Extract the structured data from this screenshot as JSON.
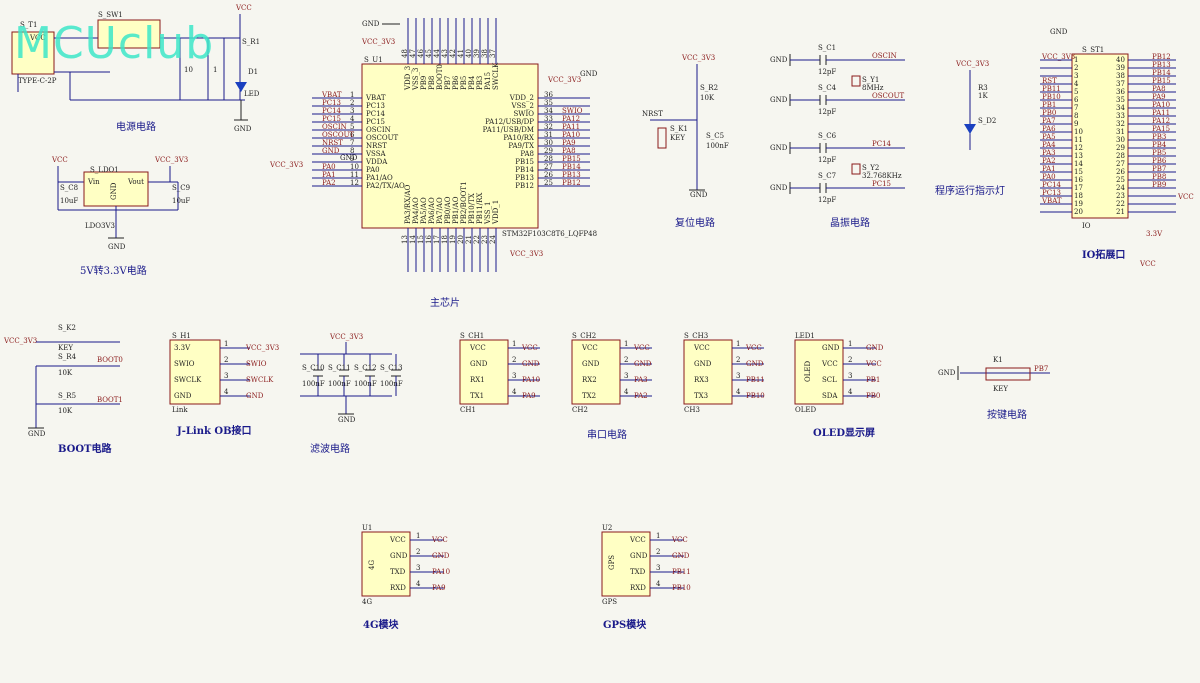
{
  "watermark": "MCUclub",
  "blocks": {
    "power": "电源电路",
    "ldo": "5V转3.3V电路",
    "mcu": "主芯片",
    "reset": "复位电路",
    "crystal": "晶振电路",
    "led": "程序运行指示灯",
    "io": "IO拓展口",
    "boot": "BOOT电路",
    "jlink": "J-Link OB接口",
    "filter": "滤波电路",
    "uart": "串口电路",
    "oled": "OLED显示屏",
    "key": "按键电路",
    "m4g": "4G模块",
    "gps": "GPS模块"
  },
  "parts": {
    "t1": "S_T1",
    "t1_type": "TYPE-C-2P",
    "sw1": "S_SW1",
    "r1": "S_R1",
    "d1": "D1",
    "led": "LED",
    "ldo1": "S_LDO1",
    "ldo_part": "LDO3V3",
    "c8": "S_C8",
    "c9": "S_C9",
    "u1": "S_U1",
    "mcu_part": "STM32F103C8T6_LQFP48",
    "r2": "S_R2",
    "r2v": "10K",
    "k1": "S_K1",
    "key": "KEY",
    "c5": "S_C5",
    "c5v": "100nF",
    "c1": "S_C1",
    "c4": "S_C4",
    "c6": "S_C6",
    "c7": "S_C7",
    "cap12": "12pF",
    "y1": "S_Y1",
    "y1v": "8MHz",
    "y2": "S_Y2",
    "y2v": "32.768KHz",
    "r3": "R3",
    "r3v": "1K",
    "d2": "S_D2",
    "st1": "S_ST1",
    "io_ref": "IO",
    "c3v": "3.3V",
    "k2": "S_K2",
    "r4": "S_R4",
    "r5": "S_R5",
    "r10k": "10K",
    "h1": "S_H1",
    "link": "Link",
    "c10": "S_C10",
    "c11": "S_C11",
    "c12": "S_C12",
    "c13": "S_C13",
    "c100n": "100nF",
    "ch1": "S_CH1",
    "ch2": "S_CH2",
    "ch3": "S_CH3",
    "ch1n": "CH1",
    "ch2n": "CH2",
    "ch3n": "CH3",
    "led1": "LED1",
    "oled": "OLED",
    "kb": "K1",
    "u4g": "U1",
    "m4g": "4G",
    "u2": "U2",
    "gpsn": "GPS"
  },
  "nets": {
    "vcc": "VCC",
    "v33": "VCC_3V3",
    "gnd": "GND",
    "nrst": "NRST",
    "boot0": "BOOT0",
    "boot1": "BOOT1",
    "oscin": "OSCIN",
    "oscout": "OSCOUT",
    "pc14": "PC14",
    "pc15": "PC15",
    "swio": "SWIO",
    "swclk": "SWCLK",
    "pa10": "PA10",
    "pa9": "PA9",
    "pa3": "PA3",
    "pa2": "PA2",
    "pb11": "PB11",
    "pb10": "PB10",
    "pb1": "PB1",
    "pb0": "PB0",
    "pb7": "PB7"
  },
  "mcu_left": [
    {
      "n": "VBAT",
      "p": "1",
      "net": "VBAT"
    },
    {
      "n": "PC13",
      "p": "2",
      "net": "PC13"
    },
    {
      "n": "PC14",
      "p": "3",
      "net": "PC14"
    },
    {
      "n": "PC15",
      "p": "4",
      "net": "PC15"
    },
    {
      "n": "OSCIN",
      "p": "5",
      "net": "OSCIN"
    },
    {
      "n": "OSCOUT",
      "p": "6",
      "net": "OSCOUT"
    },
    {
      "n": "NRST",
      "p": "7",
      "net": "NRST"
    },
    {
      "n": "VSSA",
      "p": "8",
      "net": "GND"
    },
    {
      "n": "VDDA",
      "p": "9",
      "net": ""
    },
    {
      "n": "PA0",
      "p": "10",
      "net": "PA0"
    },
    {
      "n": "PA1/AO",
      "p": "11",
      "net": "PA1"
    },
    {
      "n": "PA2/TX/AO",
      "p": "12",
      "net": "PA2"
    }
  ],
  "mcu_right": [
    {
      "n": "VDD_2",
      "p": "36",
      "net": ""
    },
    {
      "n": "VSS_2",
      "p": "35",
      "net": ""
    },
    {
      "n": "SWIO",
      "p": "34",
      "net": "SWIO"
    },
    {
      "n": "PA12/USB/DP",
      "p": "33",
      "net": "PA12"
    },
    {
      "n": "PA11/USB/DM",
      "p": "32",
      "net": "PA11"
    },
    {
      "n": "PA10/RX",
      "p": "31",
      "net": "PA10"
    },
    {
      "n": "PA9/TX",
      "p": "30",
      "net": "PA9"
    },
    {
      "n": "PA8",
      "p": "29",
      "net": "PA8"
    },
    {
      "n": "PB15",
      "p": "28",
      "net": "PB15"
    },
    {
      "n": "PB14",
      "p": "27",
      "net": "PB14"
    },
    {
      "n": "PB13",
      "p": "26",
      "net": "PB13"
    },
    {
      "n": "PB12",
      "p": "25",
      "net": "PB12"
    }
  ],
  "mcu_top": [
    {
      "n": "VDD_3",
      "p": "48"
    },
    {
      "n": "VSS_3",
      "p": "47"
    },
    {
      "n": "PB9",
      "p": "46"
    },
    {
      "n": "PB8",
      "p": "45"
    },
    {
      "n": "BOOT0",
      "p": "44"
    },
    {
      "n": "PB7",
      "p": "43"
    },
    {
      "n": "PB6",
      "p": "42"
    },
    {
      "n": "PB5",
      "p": "41"
    },
    {
      "n": "PB4",
      "p": "40"
    },
    {
      "n": "PB3",
      "p": "39"
    },
    {
      "n": "PA15",
      "p": "38"
    },
    {
      "n": "SWCLK",
      "p": "37"
    }
  ],
  "mcu_bottom": [
    {
      "n": "PA3/RX/AO",
      "p": "13"
    },
    {
      "n": "PA4/AO",
      "p": "14"
    },
    {
      "n": "PA5/AO",
      "p": "15"
    },
    {
      "n": "PA6/AO",
      "p": "16"
    },
    {
      "n": "PA7/AO",
      "p": "17"
    },
    {
      "n": "PB0/AO",
      "p": "18"
    },
    {
      "n": "PB1/AO",
      "p": "19"
    },
    {
      "n": "PB2/BOOT1",
      "p": "20"
    },
    {
      "n": "PB10/TX",
      "p": "21"
    },
    {
      "n": "PB11/RX",
      "p": "22"
    },
    {
      "n": "VSS_1",
      "p": "23"
    },
    {
      "n": "VDD_1",
      "p": "24"
    }
  ],
  "io_left": [
    {
      "p": "1",
      "net": "VCC_3V3"
    },
    {
      "p": "2",
      "net": ""
    },
    {
      "p": "3",
      "net": ""
    },
    {
      "p": "4",
      "net": "RST"
    },
    {
      "p": "5",
      "net": "PB11"
    },
    {
      "p": "6",
      "net": "PB10"
    },
    {
      "p": "7",
      "net": "PB1"
    },
    {
      "p": "8",
      "net": "PB0"
    },
    {
      "p": "9",
      "net": "PA7"
    },
    {
      "p": "10",
      "net": "PA6"
    },
    {
      "p": "11",
      "net": "PA5"
    },
    {
      "p": "12",
      "net": "PA4"
    },
    {
      "p": "13",
      "net": "PA3"
    },
    {
      "p": "14",
      "net": "PA2"
    },
    {
      "p": "15",
      "net": "PA1"
    },
    {
      "p": "16",
      "net": "PA0"
    },
    {
      "p": "17",
      "net": "PC14"
    },
    {
      "p": "18",
      "net": "PC13"
    },
    {
      "p": "19",
      "net": "VBAT"
    },
    {
      "p": "20",
      "net": ""
    }
  ],
  "io_right": [
    {
      "p": "40",
      "net": "PB12"
    },
    {
      "p": "39",
      "net": "PB13"
    },
    {
      "p": "38",
      "net": "PB14"
    },
    {
      "p": "37",
      "net": "PB15"
    },
    {
      "p": "36",
      "net": "PA8"
    },
    {
      "p": "35",
      "net": "PA9"
    },
    {
      "p": "34",
      "net": "PA10"
    },
    {
      "p": "33",
      "net": "PA11"
    },
    {
      "p": "32",
      "net": "PA12"
    },
    {
      "p": "31",
      "net": "PA15"
    },
    {
      "p": "30",
      "net": "PB3"
    },
    {
      "p": "29",
      "net": "PB4"
    },
    {
      "p": "28",
      "net": "PB5"
    },
    {
      "p": "27",
      "net": "PB6"
    },
    {
      "p": "26",
      "net": "PB7"
    },
    {
      "p": "25",
      "net": "PB8"
    },
    {
      "p": "24",
      "net": "PB9"
    },
    {
      "p": "23",
      "net": ""
    },
    {
      "p": "22",
      "net": ""
    },
    {
      "p": "21",
      "net": ""
    }
  ],
  "uart_pins": [
    "VCC",
    "GND",
    "RX1",
    "TX1",
    "RX2",
    "TX2",
    "RX3",
    "TX3"
  ],
  "jlink_pins": [
    "3.3V",
    "SWIO",
    "SWCLK",
    "GND"
  ],
  "oled_pins": [
    "GND",
    "VCC",
    "SCL",
    "SDA"
  ],
  "module_pins": [
    "VCC",
    "GND",
    "TXD",
    "RXD"
  ],
  "pin_nums": [
    "1",
    "2",
    "3",
    "4"
  ]
}
